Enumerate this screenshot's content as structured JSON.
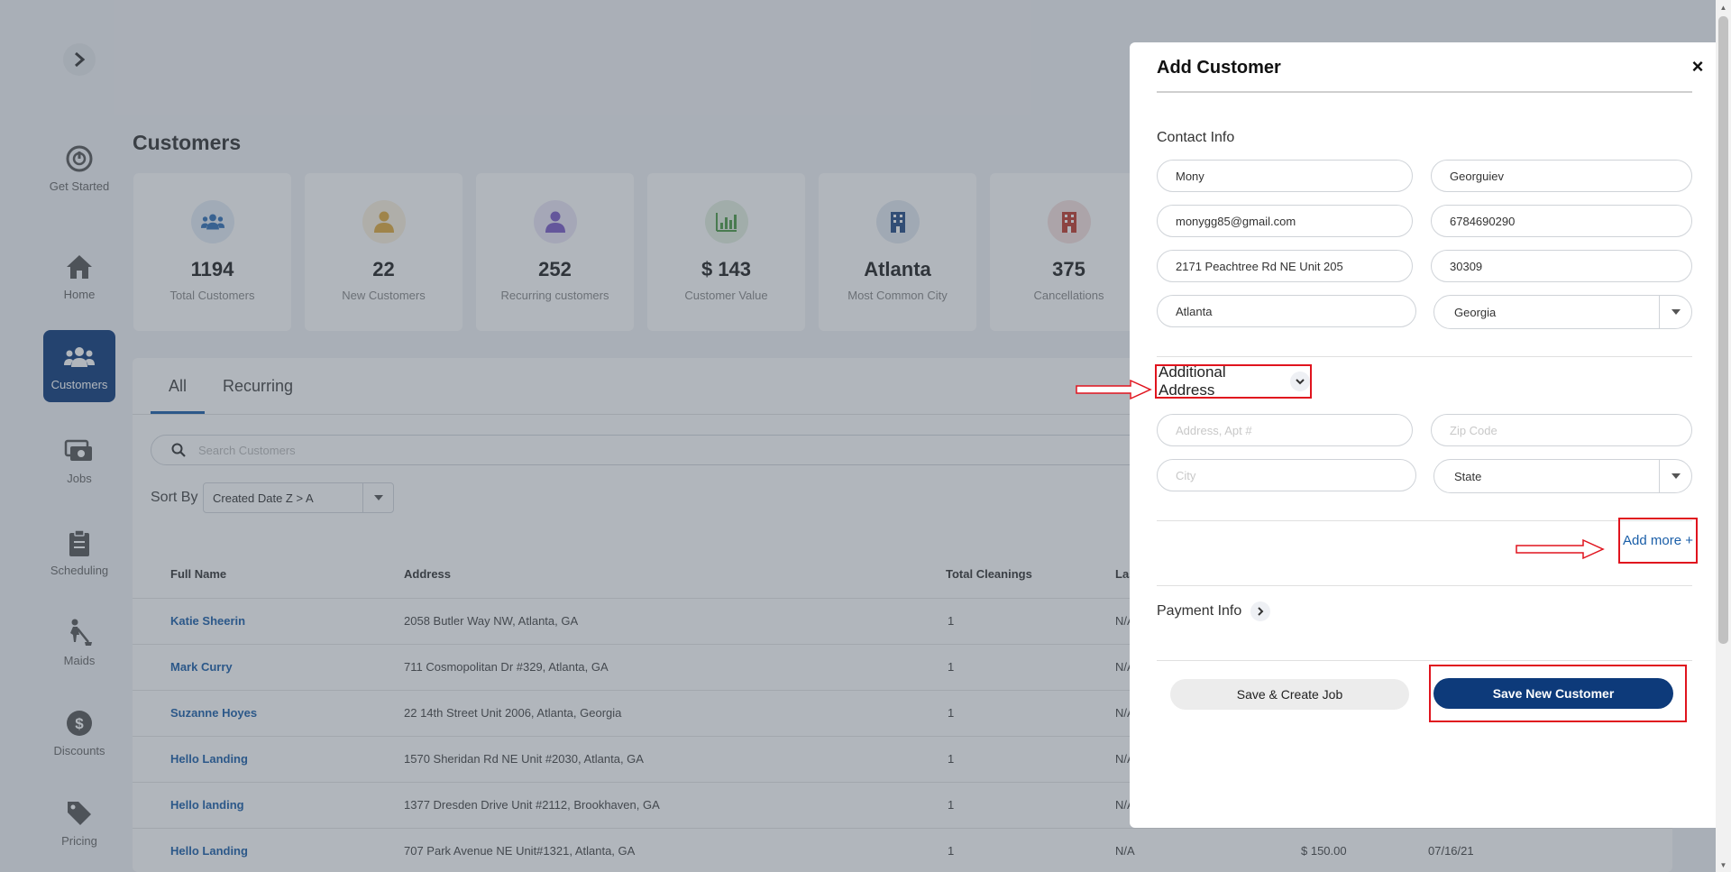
{
  "sidebar": {
    "items": [
      {
        "label": "Get Started",
        "icon": "power-icon"
      },
      {
        "label": "Home",
        "icon": "home-icon"
      },
      {
        "label": "Customers",
        "icon": "users-icon"
      },
      {
        "label": "Jobs",
        "icon": "jobs-icon"
      },
      {
        "label": "Scheduling",
        "icon": "clipboard-icon"
      },
      {
        "label": "Maids",
        "icon": "maid-icon"
      },
      {
        "label": "Discounts",
        "icon": "dollar-icon"
      },
      {
        "label": "Pricing",
        "icon": "tag-icon"
      }
    ]
  },
  "page": {
    "title": "Customers"
  },
  "stats": [
    {
      "value": "1194",
      "label": "Total Customers",
      "icon_color": "#2f6fb6"
    },
    {
      "value": "22",
      "label": "New Customers",
      "icon_color": "#e0a93b"
    },
    {
      "value": "252",
      "label": "Recurring customers",
      "icon_color": "#7a5bc7"
    },
    {
      "value": "$ 143",
      "label": "Customer Value",
      "icon_color": "#4c9a45"
    },
    {
      "value": "Atlanta",
      "label": "Most Common City",
      "icon_color": "#244b85"
    },
    {
      "value": "375",
      "label": "Cancellations",
      "icon_color": "#c0392b"
    }
  ],
  "tabs": {
    "all": "All",
    "recurring": "Recurring"
  },
  "search": {
    "placeholder": "Search Customers"
  },
  "sort": {
    "label": "Sort By",
    "value": "Created Date Z > A"
  },
  "table": {
    "headers": {
      "name": "Full Name",
      "address": "Address",
      "cleanings": "Total Cleanings",
      "last": "Las"
    },
    "rows": [
      {
        "name": "Katie Sheerin",
        "address": "2058 Butler Way NW, Atlanta, GA",
        "cleanings": "1",
        "last": "N/A",
        "amount": "",
        "date": ""
      },
      {
        "name": "Mark Curry",
        "address": "711 Cosmopolitan Dr #329, Atlanta, GA",
        "cleanings": "1",
        "last": "N/A",
        "amount": "",
        "date": ""
      },
      {
        "name": "Suzanne Hoyes",
        "address": "22 14th Street Unit 2006, Atlanta, Georgia",
        "cleanings": "1",
        "last": "N/A",
        "amount": "",
        "date": ""
      },
      {
        "name": "Hello Landing",
        "address": "1570 Sheridan Rd NE Unit #2030, Atlanta, GA",
        "cleanings": "1",
        "last": "N/A",
        "amount": "",
        "date": ""
      },
      {
        "name": "Hello landing",
        "address": "1377 Dresden Drive Unit #2112, Brookhaven, GA",
        "cleanings": "1",
        "last": "N/A",
        "amount": "",
        "date": ""
      },
      {
        "name": "Hello Landing",
        "address": "707 Park Avenue NE Unit#1321, Atlanta, GA",
        "cleanings": "1",
        "last": "N/A",
        "amount": "$ 150.00",
        "date": "07/16/21"
      }
    ]
  },
  "modal": {
    "title": "Add Customer",
    "close": "×",
    "contact_label": "Contact Info",
    "contact": {
      "first_name": "Mony",
      "last_name": "Georguiev",
      "email": "monygg85@gmail.com",
      "phone": "6784690290",
      "address": "2171 Peachtree Rd NE Unit 205",
      "zip": "30309",
      "city": "Atlanta",
      "state": "Georgia"
    },
    "additional_label": "Additional Address",
    "additional": {
      "address_placeholder": "Address, Apt #",
      "zip_placeholder": "Zip Code",
      "city_placeholder": "City",
      "state": "State"
    },
    "add_more": "Add more +",
    "payment_label": "Payment Info",
    "save_create_job": "Save & Create Job",
    "save_new_customer": "Save New Customer"
  },
  "colors": {
    "primary": "#0d3a7a",
    "link": "#1a5ea8",
    "highlight": "#e0141e"
  }
}
